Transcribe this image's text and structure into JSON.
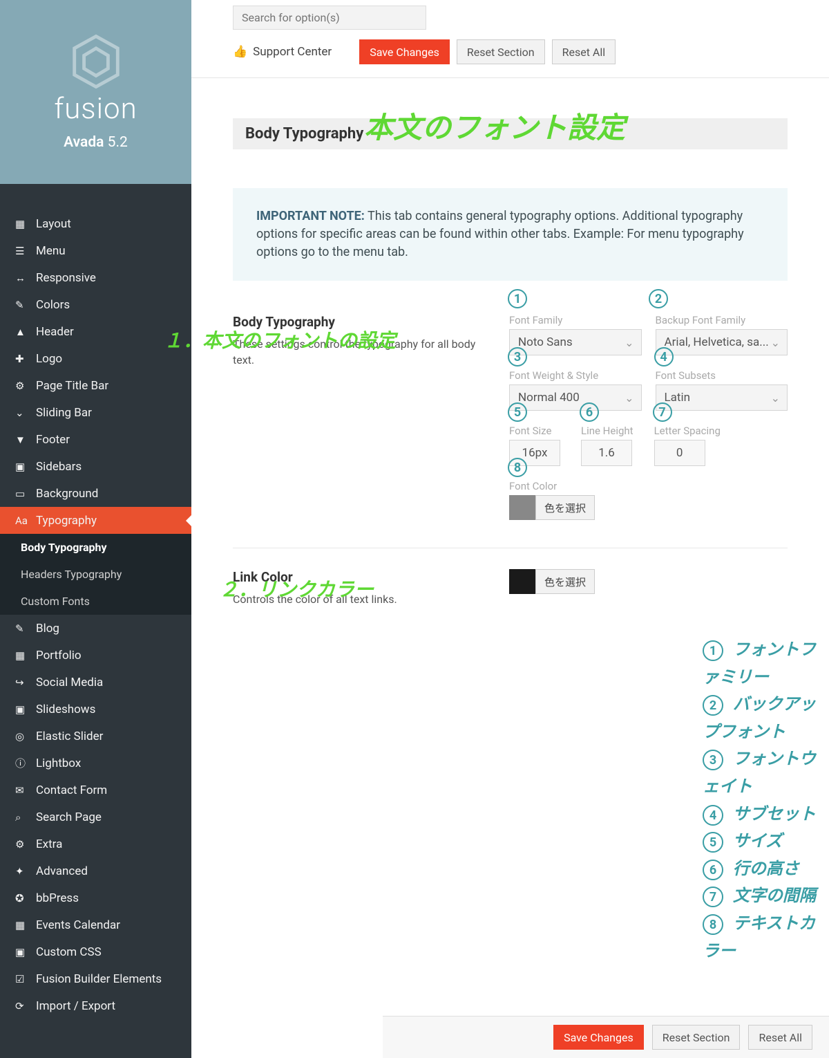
{
  "brand": {
    "name": "fusion",
    "product": "Avada",
    "version": "5.2"
  },
  "search": {
    "placeholder": "Search for option(s)"
  },
  "topbar": {
    "support": "Support Center",
    "save": "Save Changes",
    "reset_section": "Reset Section",
    "reset_all": "Reset All"
  },
  "sidebar": {
    "items": [
      {
        "label": "Layout"
      },
      {
        "label": "Menu"
      },
      {
        "label": "Responsive"
      },
      {
        "label": "Colors"
      },
      {
        "label": "Header"
      },
      {
        "label": "Logo"
      },
      {
        "label": "Page Title Bar"
      },
      {
        "label": "Sliding Bar"
      },
      {
        "label": "Footer"
      },
      {
        "label": "Sidebars"
      },
      {
        "label": "Background"
      },
      {
        "label": "Typography"
      },
      {
        "label": "Blog"
      },
      {
        "label": "Portfolio"
      },
      {
        "label": "Social Media"
      },
      {
        "label": "Slideshows"
      },
      {
        "label": "Elastic Slider"
      },
      {
        "label": "Lightbox"
      },
      {
        "label": "Contact Form"
      },
      {
        "label": "Search Page"
      },
      {
        "label": "Extra"
      },
      {
        "label": "Advanced"
      },
      {
        "label": "bbPress"
      },
      {
        "label": "Events Calendar"
      },
      {
        "label": "Custom CSS"
      },
      {
        "label": "Fusion Builder Elements"
      },
      {
        "label": "Import / Export"
      }
    ],
    "sub_items": [
      {
        "label": "Body Typography"
      },
      {
        "label": "Headers Typography"
      },
      {
        "label": "Custom Fonts"
      }
    ]
  },
  "section": {
    "title": "Body Typography"
  },
  "infobox": {
    "bold": "IMPORTANT NOTE:",
    "text": "This tab contains general typography options. Additional typography options for specific areas can be found within other tabs. Example: For menu typography options go to the menu tab."
  },
  "body_typography": {
    "heading": "Body Typography",
    "desc": "These settings control the typography for all body text.",
    "labels": {
      "font_family": "Font Family",
      "backup_font_family": "Backup Font Family",
      "font_weight_style": "Font Weight & Style",
      "font_subsets": "Font Subsets",
      "font_size": "Font Size",
      "line_height": "Line Height",
      "letter_spacing": "Letter Spacing",
      "font_color": "Font Color"
    },
    "values": {
      "font_family": "Noto Sans",
      "backup_font_family": "Arial, Helvetica, sa...",
      "font_weight_style": "Normal 400",
      "font_subsets": "Latin",
      "font_size": "16px",
      "line_height": "1.6",
      "letter_spacing": "0",
      "color_button": "色を選択"
    }
  },
  "link_color": {
    "heading": "Link Color",
    "desc": "Controls the color of all text links.",
    "color_button": "色を選択"
  },
  "annotations": {
    "heading_jp": "本文のフォント設定",
    "section1": "１．本文のフォントの設定",
    "section2": "２．リンクカラー",
    "nums": {
      "1": "1",
      "2": "2",
      "3": "3",
      "4": "4",
      "5": "5",
      "6": "6",
      "7": "7",
      "8": "8"
    },
    "legend": [
      "フォントファミリー",
      "バックアップフォント",
      "フォントウェイト",
      "サブセット",
      "サイズ",
      "行の高さ",
      "文字の間隔",
      "テキストカラー"
    ]
  },
  "bottom": {
    "save": "Save Changes",
    "reset_section": "Reset Section",
    "reset_all": "Reset All"
  }
}
